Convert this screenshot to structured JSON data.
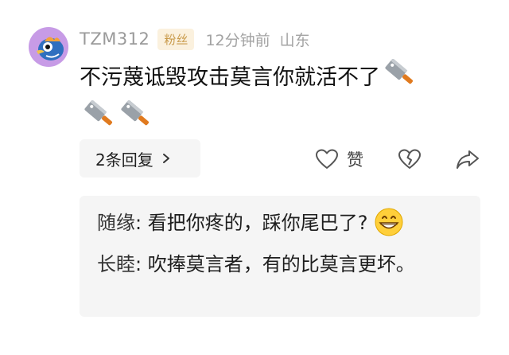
{
  "comment": {
    "username": "TZM312",
    "badge": "粉丝",
    "time": "12分钟前",
    "location": "山东",
    "text": "不污蔑诋毁攻击莫言你就活不了",
    "trailing_emojis": [
      "cleaver-knife-icon",
      "cleaver-knife-icon",
      "cleaver-knife-icon"
    ]
  },
  "actions": {
    "replies_label": "2条回复",
    "like_label": "赞"
  },
  "replies": [
    {
      "name": "随缘",
      "separator": ": ",
      "text": "看把你疼的，踩你尾巴了?",
      "emoji": "grinning-face-icon"
    },
    {
      "name": "长睦",
      "separator": ": ",
      "text": "吹捧莫言者，有的比莫言更坏。"
    }
  ],
  "colors": {
    "username": "#9a9a9a",
    "badge_bg": "#fbf1de",
    "badge_text": "#c99a4a",
    "reply_box_bg": "#f5f5f5",
    "avatar_bg": "#c79be6",
    "cleaver_handle": "#e07a1f"
  }
}
